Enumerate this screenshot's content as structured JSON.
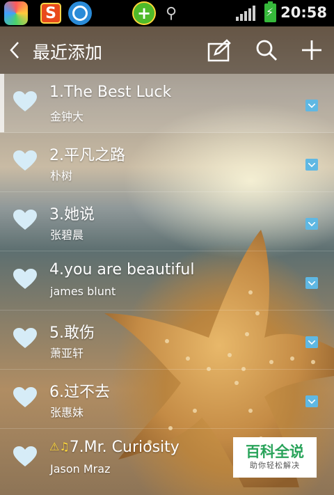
{
  "status_bar": {
    "app2_letter": "S",
    "time": "20:58",
    "icons": [
      "app-store-icon",
      "sogou-icon",
      "browser-icon",
      "security-plus-icon",
      "usb-icon",
      "signal-icon",
      "battery-charging-icon"
    ]
  },
  "app_bar": {
    "title": "最近添加",
    "icons": [
      "back-icon",
      "edit-icon",
      "search-icon",
      "add-icon"
    ]
  },
  "songs": [
    {
      "title": "1.The Best Luck",
      "artist": "金钟大"
    },
    {
      "title": "2.平凡之路",
      "artist": "朴树"
    },
    {
      "title": "3.她说",
      "artist": "张碧晨"
    },
    {
      "title": "4.you are beautiful",
      "artist": "james blunt"
    },
    {
      "title": "5.敢伤",
      "artist": "萧亚轩"
    },
    {
      "title": "6.过不去",
      "artist": "张惠妹"
    },
    {
      "title": "7.Mr. Curiosity",
      "artist": "Jason Mraz",
      "warning_icon": "⚠♫"
    }
  ],
  "watermark": {
    "main": "百科全说",
    "sub": "助你轻松解决"
  },
  "colors": {
    "heart": "#d6ecf7",
    "menu_chevron_bg": "#5fb8e3",
    "watermark_text": "#29a35a"
  }
}
